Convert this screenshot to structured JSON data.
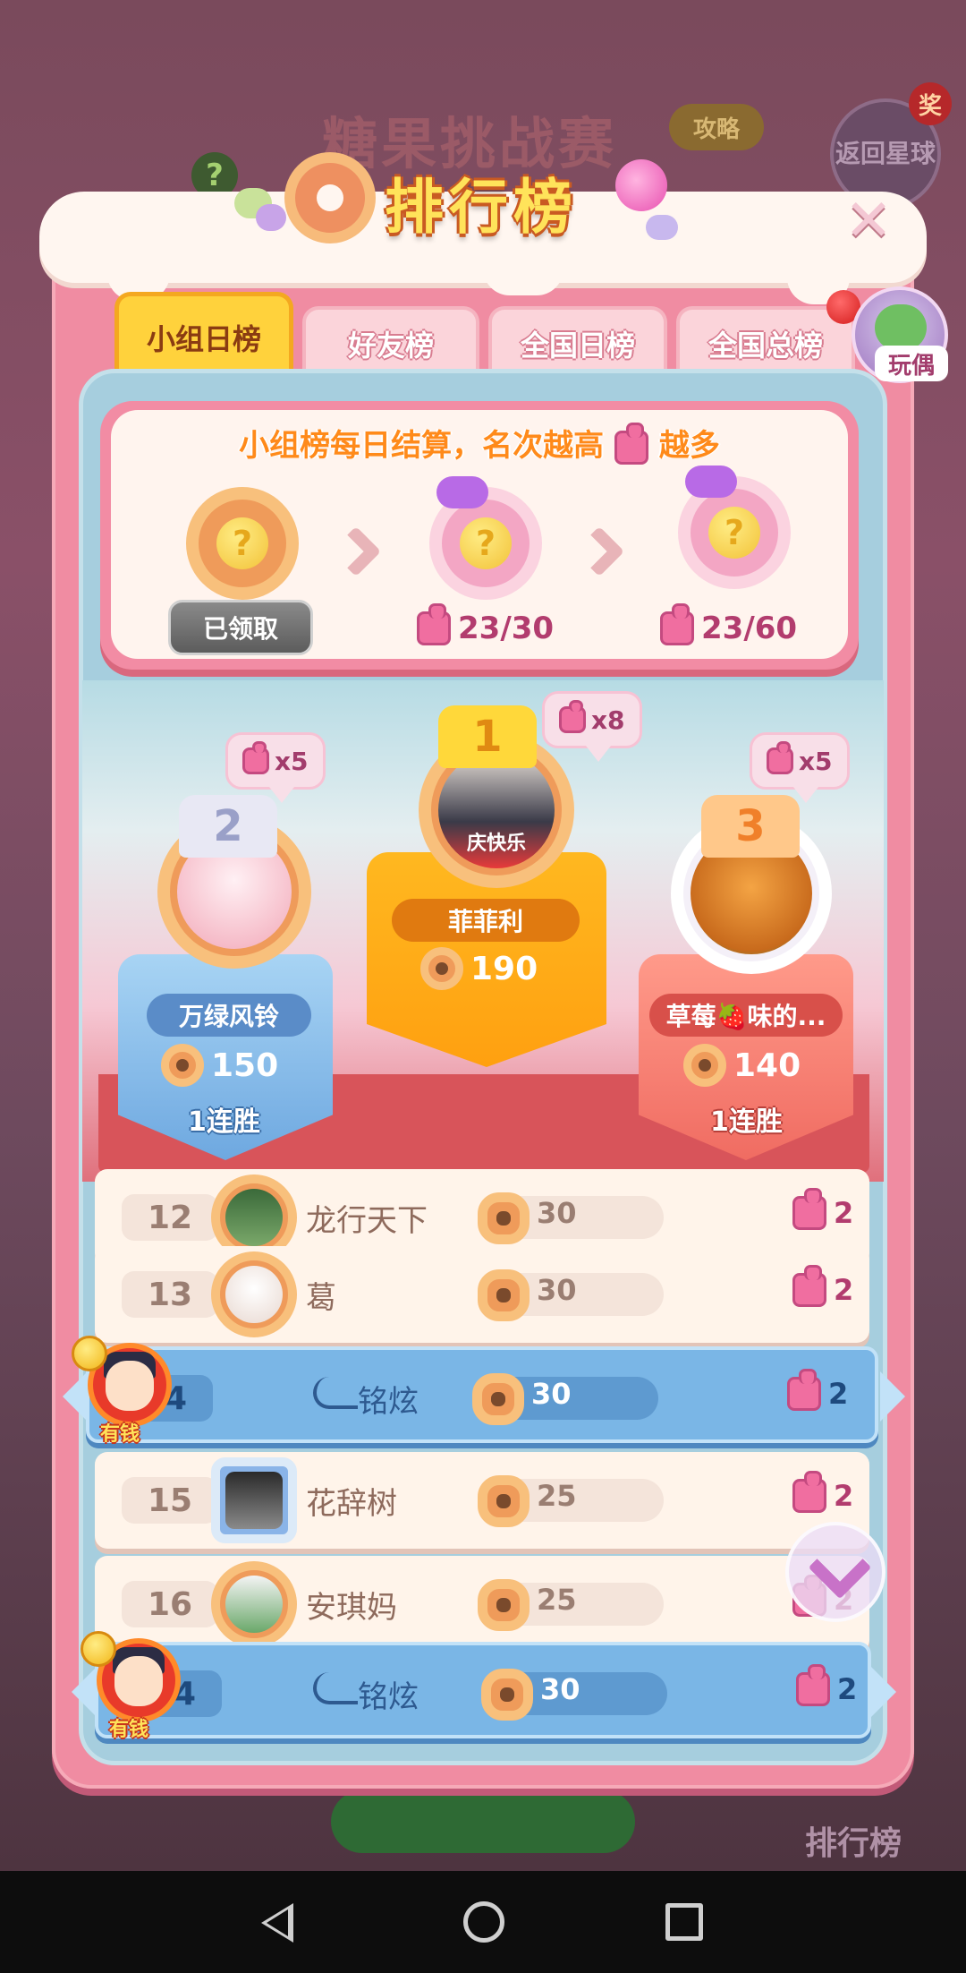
{
  "background": {
    "game_title": "糖果挑战赛",
    "strategy_label": "攻略",
    "return_label": "返回星球",
    "award_badge": "奖",
    "help_icon": "?",
    "ranking_button": "排行榜"
  },
  "panel": {
    "title": "排行榜",
    "close_icon": "✕"
  },
  "tabs": [
    {
      "label": "小组日榜",
      "active": true
    },
    {
      "label": "好友榜",
      "active": false
    },
    {
      "label": "全国日榜",
      "active": false
    },
    {
      "label": "全国总榜",
      "active": false
    }
  ],
  "doll_button": {
    "label": "玩偶"
  },
  "reward": {
    "title_before": "小组榜每日结算，名次越高",
    "title_after": "越多",
    "chest_mark": "?",
    "claimed_label": "已领取",
    "progress": [
      "23/30",
      "23/60"
    ]
  },
  "podium": {
    "first": {
      "rank": "1",
      "name": "菲菲利",
      "score": "190",
      "bubble": "x8",
      "avatar_caption": "庆快乐"
    },
    "second": {
      "rank": "2",
      "name": "万绿风铃",
      "score": "150",
      "streak": "1连胜",
      "bubble": "x5"
    },
    "third": {
      "rank": "3",
      "name": "草莓🍓味的...",
      "score": "140",
      "streak": "1连胜",
      "bubble": "x5"
    }
  },
  "rows": [
    {
      "rank": "12",
      "name": "龙行天下",
      "score": "30",
      "pieces": "2"
    },
    {
      "rank": "13",
      "name": "葛",
      "score": "30",
      "pieces": "2"
    },
    {
      "rank": "14",
      "name": "铭炫",
      "score": "30",
      "pieces": "2",
      "me": true
    },
    {
      "rank": "15",
      "name": "花辞树",
      "score": "25",
      "pieces": "2"
    },
    {
      "rank": "16",
      "name": "安琪妈",
      "score": "25",
      "pieces": "2"
    }
  ],
  "my_row": {
    "rank": "14",
    "name": "铭炫",
    "score": "30",
    "pieces": "2",
    "avatar_label": "有钱"
  },
  "colors": {
    "panel_pink": "#f08ca2",
    "tab_active": "#ffd23c",
    "me_row_blue": "#7ab6e6",
    "gold_podium": "#ffa010",
    "silver_podium": "#6ea8e0",
    "bronze_podium": "#f06c62"
  },
  "icons": [
    "help-icon",
    "close-icon",
    "donut-icon",
    "puzzle-piece-icon",
    "chevron-right-icon",
    "scroll-down-icon",
    "nav-back-icon",
    "nav-home-icon",
    "nav-recent-icon"
  ]
}
